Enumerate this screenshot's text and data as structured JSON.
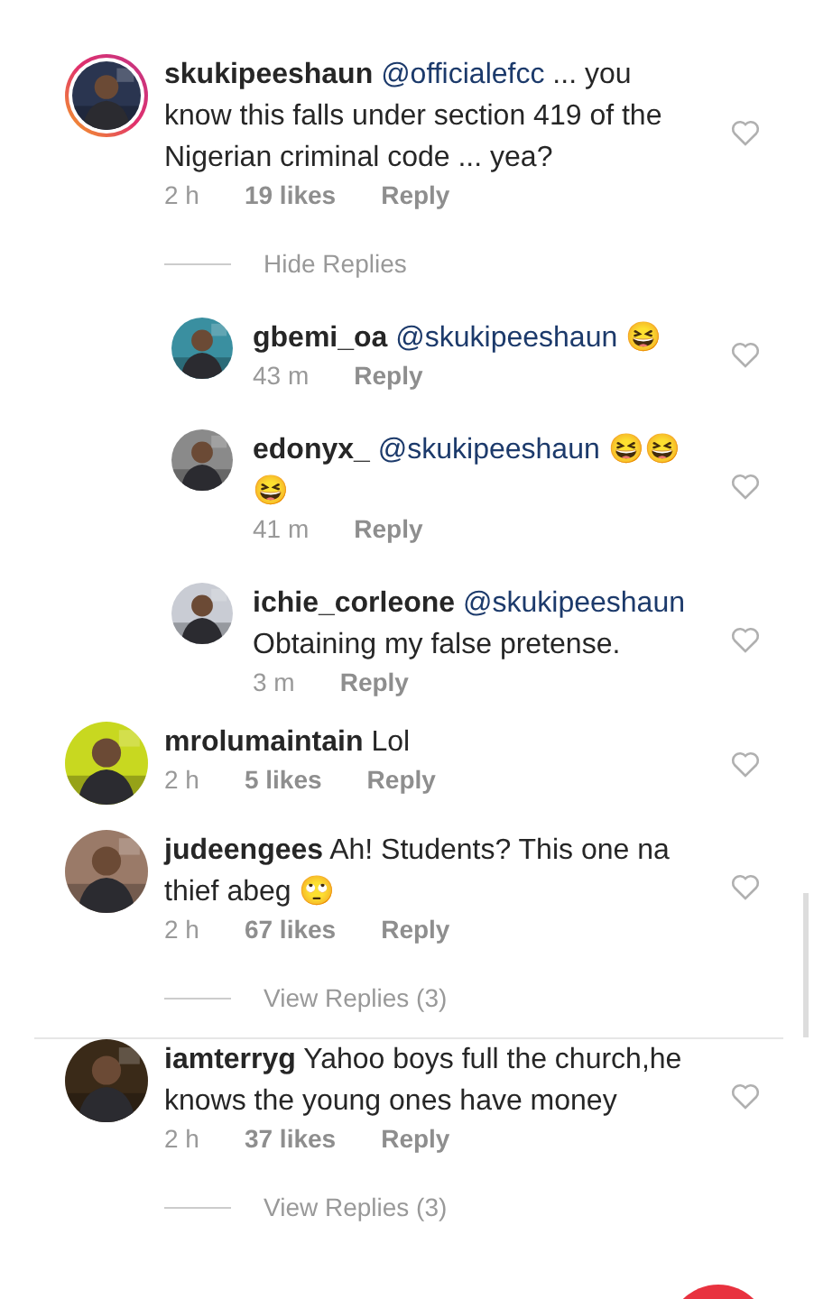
{
  "comments": [
    {
      "user": "skukipeeshaun",
      "mention": "@officialefcc",
      "text": "... you know this falls under section 419 of the Nigerian criminal code ... yea?",
      "story_ring": true,
      "divider_above": false,
      "time": "2 h",
      "likes": "19 likes",
      "reply": "Reply",
      "toggle": "Hide Replies",
      "replies": [
        {
          "user": "gbemi_oa",
          "mention": "@skukipeeshaun",
          "text": "😆",
          "time": "43 m",
          "reply": "Reply"
        },
        {
          "user": "edonyx_",
          "mention": "@skukipeeshaun",
          "text": "😆😆 😆",
          "time": "41 m",
          "reply": "Reply"
        },
        {
          "user": "ichie_corleone",
          "mention": "@skukipeeshaun",
          "text": "Obtaining my false pretense.",
          "time": "3 m",
          "reply": "Reply"
        }
      ]
    },
    {
      "user": "mrolumaintain",
      "text": "Lol",
      "story_ring": false,
      "divider_above": false,
      "time": "2 h",
      "likes": "5 likes",
      "reply": "Reply"
    },
    {
      "user": "judeengees",
      "text": "Ah! Students? This one na thief abeg 🙄",
      "story_ring": false,
      "divider_above": false,
      "time": "2 h",
      "likes": "67 likes",
      "reply": "Reply",
      "toggle": "View Replies (3)"
    },
    {
      "user": "iamterryg",
      "text": "Yahoo boys full the church,he knows the young ones have money",
      "story_ring": false,
      "divider_above": true,
      "time": "2 h",
      "likes": "37 likes",
      "reply": "Reply",
      "toggle": "View Replies (3)"
    }
  ]
}
